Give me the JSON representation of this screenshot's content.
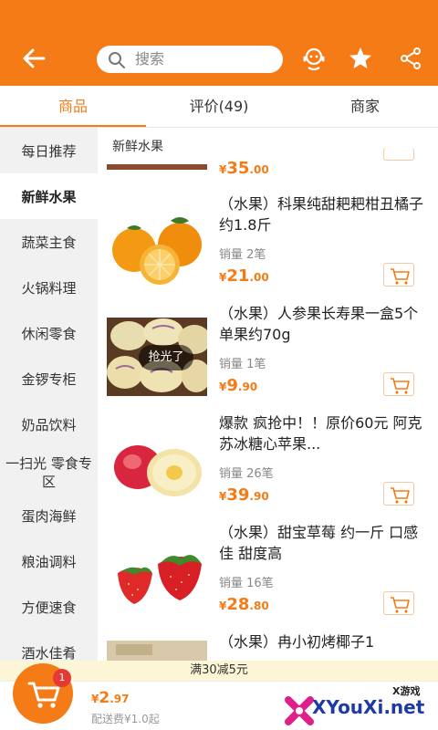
{
  "header": {
    "search_placeholder": "搜索",
    "icons": [
      "back-arrow-icon",
      "search-icon",
      "service-icon",
      "star-icon",
      "share-icon"
    ]
  },
  "tabs": [
    {
      "label": "商品",
      "active": true
    },
    {
      "label": "评价(49)",
      "active": false
    },
    {
      "label": "商家",
      "active": false
    }
  ],
  "sidebar": {
    "items": [
      {
        "label": "每日推荐"
      },
      {
        "label": "新鲜水果",
        "active": true
      },
      {
        "label": "蔬菜主食"
      },
      {
        "label": "火锅料理"
      },
      {
        "label": "休闲零食"
      },
      {
        "label": "金锣专柜"
      },
      {
        "label": "奶品饮料"
      },
      {
        "label": "一扫光 零食专区"
      },
      {
        "label": "蛋肉海鲜"
      },
      {
        "label": "粮油调料"
      },
      {
        "label": "方便速食"
      },
      {
        "label": "酒水佳肴"
      }
    ]
  },
  "content": {
    "section_title": "新鲜水果",
    "partial_top_price": {
      "cur": "¥",
      "int": "35",
      "dec": ".00"
    },
    "products": [
      {
        "name": "（水果）科果纯甜耙耙柑丑橘子 约1.8斤",
        "sales": "销量 2笔",
        "price_cur": "¥",
        "price_int": "21",
        "price_dec": ".00",
        "sold_out": false
      },
      {
        "name": "（水果）人参果长寿果一盒5个 单果约70g",
        "sales": "销量 1笔",
        "price_cur": "¥",
        "price_int": "9",
        "price_dec": ".90",
        "sold_out": true,
        "sold_out_label": "抢光了"
      },
      {
        "name": "爆款 疯抢中！！原价60元 阿克苏冰糖心苹果...",
        "sales": "销量 26笔",
        "price_cur": "¥",
        "price_int": "39",
        "price_dec": ".90",
        "sold_out": false
      },
      {
        "name": "（水果）甜宝草莓 约一斤 口感佳 甜度高",
        "sales": "销量 16笔",
        "price_cur": "¥",
        "price_int": "28",
        "price_dec": ".80",
        "sold_out": false
      },
      {
        "name": "（水果）冉小初烤椰子1",
        "sales": "",
        "price_cur": "",
        "price_int": "",
        "price_dec": "",
        "sold_out": false
      }
    ]
  },
  "promo": {
    "text": "满30减5元"
  },
  "bottom": {
    "cart_count": "1",
    "total_cur": "¥",
    "total_int": "2",
    "total_dec": ".97",
    "delivery_fee": "配送费¥1.0起"
  },
  "watermark": {
    "tag": "X游戏",
    "text": "XYouXi.net"
  },
  "colors": {
    "accent": "#f47b16",
    "badge": "#e53935",
    "promo_bg": "#fdf6d6"
  }
}
